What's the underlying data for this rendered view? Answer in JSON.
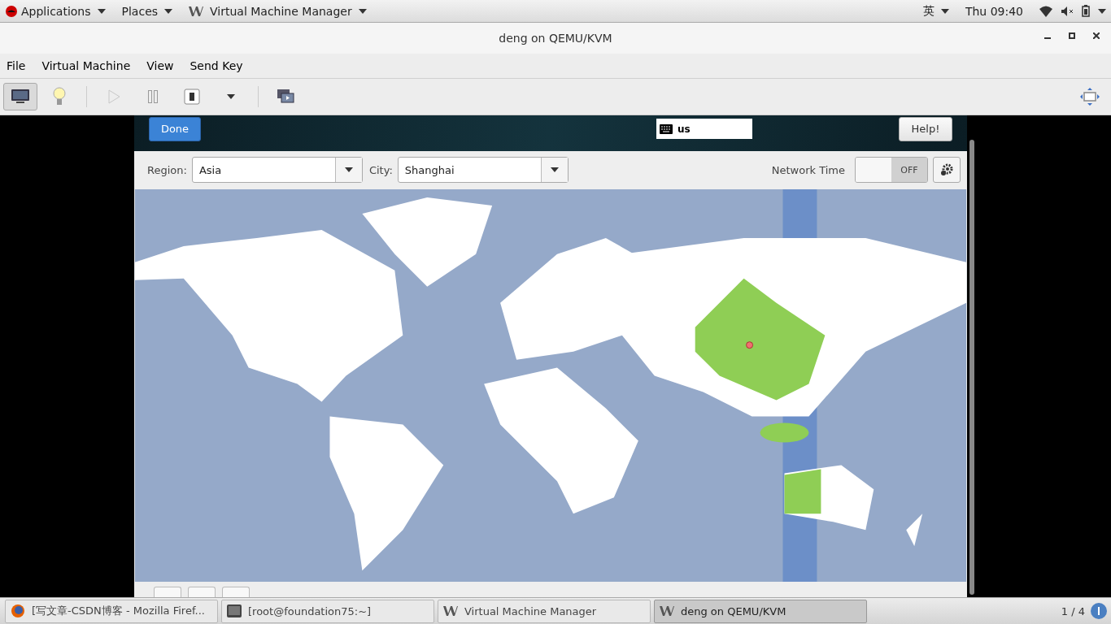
{
  "top_bar": {
    "menus": [
      "Applications",
      "Places",
      "Virtual Machine Manager"
    ],
    "input_method": "英",
    "clock": "Thu 09:40"
  },
  "window": {
    "title": "deng on QEMU/KVM"
  },
  "menu_bar": [
    "File",
    "Virtual Machine",
    "View",
    "Send Key"
  ],
  "toolbar": {
    "view_buttons": [
      {
        "kind": "console",
        "selected": true
      },
      {
        "kind": "details",
        "selected": false
      }
    ],
    "run": {
      "disabled": true
    }
  },
  "guest": {
    "done": "Done",
    "keyboard": "us",
    "help": "Help!",
    "region_label": "Region:",
    "region": "Asia",
    "city_label": "City:",
    "city": "Shanghai",
    "network_time_label": "Network Time",
    "network_time": {
      "on": false,
      "text": "OFF"
    }
  },
  "taskbar": {
    "tasks": [
      {
        "label": "[写文章-CSDN博客 - Mozilla Firef...",
        "kind": "browser",
        "selected": false
      },
      {
        "label": "[root@foundation75:~]",
        "kind": "terminal",
        "selected": false
      },
      {
        "label": "Virtual Machine Manager",
        "kind": "vmm",
        "selected": false
      },
      {
        "label": "deng on QEMU/KVM",
        "kind": "vmm",
        "selected": true
      }
    ],
    "workspace": "1 / 4"
  }
}
